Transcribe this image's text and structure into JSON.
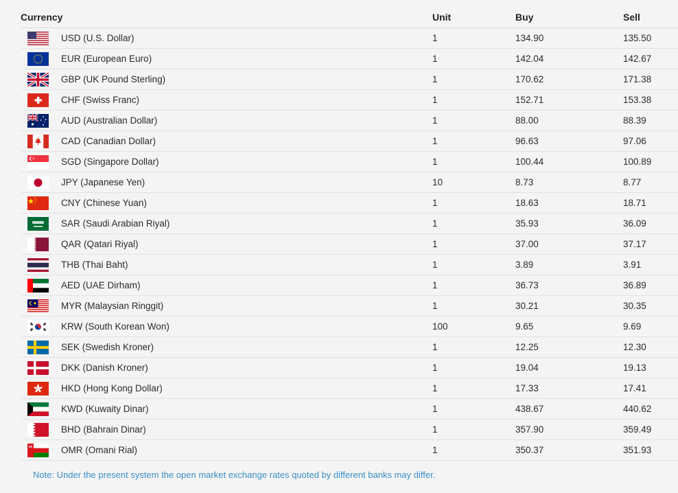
{
  "table": {
    "headers": {
      "currency": "Currency",
      "unit": "Unit",
      "buy": "Buy",
      "sell": "Sell"
    },
    "rows": [
      {
        "flag": "us-flag-icon",
        "currency": "USD (U.S. Dollar)",
        "unit": "1",
        "buy": "134.90",
        "sell": "135.50"
      },
      {
        "flag": "eu-flag-icon",
        "currency": "EUR (European Euro)",
        "unit": "1",
        "buy": "142.04",
        "sell": "142.67"
      },
      {
        "flag": "gb-flag-icon",
        "currency": "GBP (UK Pound Sterling)",
        "unit": "1",
        "buy": "170.62",
        "sell": "171.38"
      },
      {
        "flag": "ch-flag-icon",
        "currency": "CHF (Swiss Franc)",
        "unit": "1",
        "buy": "152.71",
        "sell": "153.38"
      },
      {
        "flag": "au-flag-icon",
        "currency": "AUD (Australian Dollar)",
        "unit": "1",
        "buy": "88.00",
        "sell": "88.39"
      },
      {
        "flag": "ca-flag-icon",
        "currency": "CAD (Canadian Dollar)",
        "unit": "1",
        "buy": "96.63",
        "sell": "97.06"
      },
      {
        "flag": "sg-flag-icon",
        "currency": "SGD (Singapore Dollar)",
        "unit": "1",
        "buy": "100.44",
        "sell": "100.89"
      },
      {
        "flag": "jp-flag-icon",
        "currency": "JPY (Japanese Yen)",
        "unit": "10",
        "buy": "8.73",
        "sell": "8.77"
      },
      {
        "flag": "cn-flag-icon",
        "currency": "CNY (Chinese Yuan)",
        "unit": "1",
        "buy": "18.63",
        "sell": "18.71"
      },
      {
        "flag": "sa-flag-icon",
        "currency": "SAR (Saudi Arabian Riyal)",
        "unit": "1",
        "buy": "35.93",
        "sell": "36.09"
      },
      {
        "flag": "qa-flag-icon",
        "currency": "QAR (Qatari Riyal)",
        "unit": "1",
        "buy": "37.00",
        "sell": "37.17"
      },
      {
        "flag": "th-flag-icon",
        "currency": "THB (Thai Baht)",
        "unit": "1",
        "buy": "3.89",
        "sell": "3.91"
      },
      {
        "flag": "ae-flag-icon",
        "currency": "AED (UAE Dirham)",
        "unit": "1",
        "buy": "36.73",
        "sell": "36.89"
      },
      {
        "flag": "my-flag-icon",
        "currency": "MYR (Malaysian Ringgit)",
        "unit": "1",
        "buy": "30.21",
        "sell": "30.35"
      },
      {
        "flag": "kr-flag-icon",
        "currency": "KRW (South Korean Won)",
        "unit": "100",
        "buy": "9.65",
        "sell": "9.69"
      },
      {
        "flag": "se-flag-icon",
        "currency": "SEK (Swedish Kroner)",
        "unit": "1",
        "buy": "12.25",
        "sell": "12.30"
      },
      {
        "flag": "dk-flag-icon",
        "currency": "DKK (Danish Kroner)",
        "unit": "1",
        "buy": "19.04",
        "sell": "19.13"
      },
      {
        "flag": "hk-flag-icon",
        "currency": "HKD (Hong Kong Dollar)",
        "unit": "1",
        "buy": "17.33",
        "sell": "17.41"
      },
      {
        "flag": "kw-flag-icon",
        "currency": "KWD (Kuwaity Dinar)",
        "unit": "1",
        "buy": "438.67",
        "sell": "440.62"
      },
      {
        "flag": "bh-flag-icon",
        "currency": "BHD (Bahrain Dinar)",
        "unit": "1",
        "buy": "357.90",
        "sell": "359.49"
      },
      {
        "flag": "om-flag-icon",
        "currency": "OMR (Omani Rial)",
        "unit": "1",
        "buy": "350.37",
        "sell": "351.93"
      }
    ]
  },
  "note": "Note: Under the present system the open market exchange rates quoted by different banks may differ."
}
